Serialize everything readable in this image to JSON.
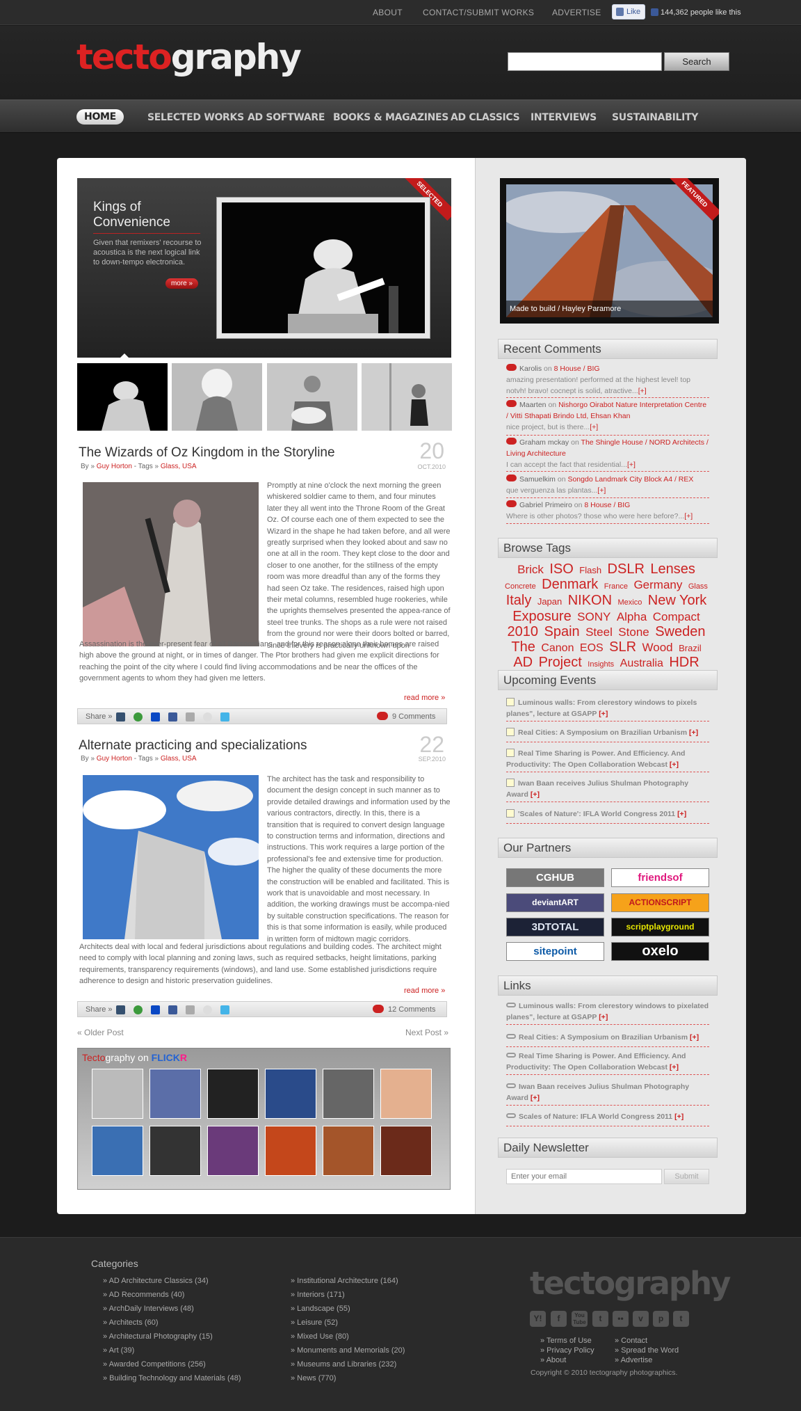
{
  "topbar": {
    "about": "ABOUT",
    "contact": "CONTACT/SUBMIT WORKS",
    "advertise": "ADVERTISE",
    "like": "Like",
    "likes": "144,362 people like this"
  },
  "brand": {
    "logo_red": "tecto",
    "logo_white": "graphy"
  },
  "search": {
    "button": "Search",
    "placeholder": ""
  },
  "nav": [
    "HOME",
    "SELECTED WORKS",
    "AD SOFTWARE",
    "BOOKS & MAGAZINES",
    "AD CLASSICS",
    "INTERVIEWS",
    "SUSTAINABILITY"
  ],
  "feature": {
    "title": "Kings of Convenience",
    "desc": "Given that remixers' recourse to acoustica is the next logical link to down-tempo electronica.",
    "more": "more »",
    "ribbon": "SELECTED"
  },
  "posts": [
    {
      "title": "The Wizards  of Oz Kingdom in the Storyline",
      "by": "By »",
      "author": "Guy Horton",
      "tags_lbl": "- Tags »",
      "tags": "Glass, USA",
      "day": "20",
      "month": "OCT.2010",
      "body": "Promptly at nine o'clock the next morning the green whiskered soldier came to them, and four minutes later they all went into the Throne Room of the Great Oz. Of course each one of them expected to see the Wizard in the shape he had taken before, and all were greatly surprised when they looked about and saw no one at all in the room. They kept close to the door and closer to one another, for the stillness of the empty room was more dreadful than any of the forms they had seen Oz take. The residences, raised high upon their metal columns, resembled huge rookeries, while the uprights themselves presented the appea-rance of steel tree trunks. The shops as a rule were not raised from the ground nor were their doors bolted or barred, since thievery is practically unknown upon",
      "body2": "Assassination is the ever-present fear of all Barsoomians, and for this reason alone their homes are raised high above the ground at night, or in times of danger. The Ptor brothers had given me explicit directions for reaching the point of the city where I could find living accommodations and be near the offices of the government agents to whom they had given me letters.",
      "readmore": "read more »",
      "share": "Share »",
      "comments": "9 Comments"
    },
    {
      "title": "Alternate practicing and specializations",
      "by": "By »",
      "author": "Guy Horton",
      "tags_lbl": "- Tags »",
      "tags": "Glass, USA",
      "day": "22",
      "month": "SEP.2010",
      "body": "The architect has the task and responsibility to document the design concept in such manner as to provide detailed drawings and information used by the various contractors, directly. In this, there is a transition that is required to convert design language to construction terms and information, directions and instructions. This work requires a large portion of the professional's fee and extensive time for production. The higher the quality of these documents the more the construction will be enabled and facilitated. This is work that is unavoidable and most necessary. In addition, the working drawings must be accompa-nied by suitable construction specifications. The reason for this is that some information is easily, while produced in written form of midtown magic corridors.",
      "body2": "Architects deal with local and federal jurisdictions about regulations and building codes. The architect might need to comply with local planning and zoning laws, such as required setbacks, height limitations, parking requirements, transparency requirements (windows), and land use. Some established jurisdictions require adherence to design and historic preservation guidelines.",
      "readmore": "read more »",
      "share": "Share »",
      "comments": "12 Comments"
    }
  ],
  "pager": {
    "older": "« Older Post",
    "newer": "Next Post »"
  },
  "flickr": {
    "red": "Tecto",
    "white": "graphy on ",
    "blue": "FLICK",
    "pink": "R"
  },
  "sidebar": {
    "featured_caption": "Made to build / Hayley Paramore",
    "featured_ribbon": "FEATURED",
    "recent_head": "Recent Comments",
    "comments": [
      {
        "name": "Karolis",
        "on": "on",
        "post": "8 House / BIG",
        "text": "amazing presentation! performed at the highest level! top notvh! bravo! cocnept is solid, atractive...",
        "plus": "[+]"
      },
      {
        "name": "Maarten",
        "on": "on",
        "post": "Nishorgo Oirabot Nature Interpretation Centre / Vitti Sthapati Brindo Ltd, Ehsan Khan",
        "text": "nice project, but is there...",
        "plus": "[+]"
      },
      {
        "name": "Graham mckay",
        "on": "on",
        "post": "The Shingle House / NORD Architects / Living Architecture",
        "text": "I can accept the fact that residential...",
        "plus": "[+]"
      },
      {
        "name": "Samuelkim",
        "on": "on",
        "post": "Songdo Landmark City Block A4 / REX",
        "text": "que verguenza las plantas...",
        "plus": "[+]"
      },
      {
        "name": "Gabriel Primeiro",
        "on": "on",
        "post": "8 House / BIG",
        "text": "Where is other photos? those who were here before?...",
        "plus": "[+]"
      }
    ],
    "tags_head": "Browse Tags",
    "tag_list": [
      "Brick",
      "ISO",
      "Flash",
      "DSLR",
      "Lenses",
      "Concrete",
      "Denmark",
      "France",
      "Germany",
      "Glass",
      "Italy",
      "Japan",
      "NIKON",
      "Mexico",
      "New York",
      "Exposure",
      "SONY",
      "Alpha",
      "Compact",
      "2010",
      "Spain",
      "Steel",
      "Stone",
      "Sweden",
      "The",
      "Canon",
      "EOS",
      "SLR",
      "Wood",
      "Brazil",
      "AD",
      "Project",
      "Insights",
      "Australia",
      "HDR"
    ],
    "events_head": "Upcoming Events",
    "events": [
      {
        "text": "Luminous walls: From clerestory windows to pixels planes\", lecture at GSAPP",
        "plus": "[+]"
      },
      {
        "text": "Real Cities: A Symposium on Brazilian Urbanism",
        "plus": "[+]"
      },
      {
        "text": "Real Time Sharing is Power. And Efficiency. And Productivity: The Open Collaboration Webcast",
        "plus": "[+]"
      },
      {
        "text": "Iwan Baan receives Julius Shulman Photography Award",
        "plus": "[+]"
      },
      {
        "text": "'Scales of Nature': IFLA World Congress 2011",
        "plus": "[+]"
      }
    ],
    "partners_head": "Our Partners",
    "partners": [
      "CGHUB",
      "friendsof",
      "deviantART",
      "ACTIONSCRIPT",
      "3DTOTAL",
      "scriptplayground",
      "sitepoint",
      "oxelo"
    ],
    "links_head": "Links",
    "links": [
      {
        "text": "Luminous walls: From clerestory windows to pixelated planes\", lecture at GSAPP",
        "plus": "[+]"
      },
      {
        "text": "Real Cities: A Symposium on Brazilian Urbanism",
        "plus": "[+]"
      },
      {
        "text": "Real Time Sharing is Power. And Efficiency. And Productivity: The Open Collaboration Webcast",
        "plus": "[+]"
      },
      {
        "text": "Iwan Baan receives Julius Shulman Photography Award",
        "plus": "[+]"
      },
      {
        "text": "Scales of Nature: IFLA World Congress 2011",
        "plus": "[+]"
      }
    ],
    "newsletter_head": "Daily Newsletter",
    "email_placeholder": "Enter your email",
    "submit": "Submit"
  },
  "footer": {
    "categories_head": "Categories",
    "col1": [
      "» AD Architecture Classics (34)",
      "» AD Recommends (40)",
      "» ArchDaily Interviews (48)",
      "» Architects (60)",
      "» Architectural Photography (15)",
      "» Art (39)",
      "» Awarded Competitions (256)",
      "» Building Technology and Materials (48)"
    ],
    "col2": [
      "» Institutional Architecture (164)",
      "» Interiors (171)",
      "» Landscape (55)",
      "» Leisure (52)",
      "» Mixed Use (80)",
      "» Monuments and Memorials (20)",
      "» Museums and Libraries (232)",
      "» News (770)"
    ],
    "logo": "tectography",
    "social": [
      "Y!",
      "f",
      "You Tube",
      "t",
      "••",
      "v",
      "p",
      "t"
    ],
    "links1": [
      "» Terms of Use",
      "» Privacy Policy",
      "» About"
    ],
    "links2": [
      "» Contact",
      "» Spread the Word",
      "» Advertise"
    ],
    "copyright": "Copyright © 2010 tectography photographics."
  }
}
